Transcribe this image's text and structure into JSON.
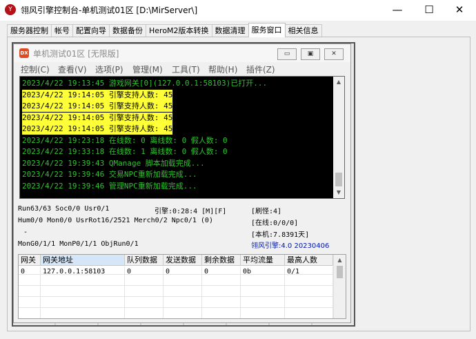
{
  "window": {
    "title": "翎风引擎控制台-单机测试01区 [D:\\MirServer\\]",
    "icon": "engine-logo-icon",
    "minimize": "—",
    "maximize": "☐",
    "close": "✕"
  },
  "tabs": [
    {
      "label": "服务器控制"
    },
    {
      "label": "帐号"
    },
    {
      "label": "配置向导"
    },
    {
      "label": "数据备份"
    },
    {
      "label": "HeroM2版本转换"
    },
    {
      "label": "数据清理"
    },
    {
      "label": "服务窗口",
      "active": true
    },
    {
      "label": "相关信息"
    }
  ],
  "server_window": {
    "title": "单机测试01区 [无限版]",
    "icon_label": "DX",
    "buttons": {
      "minimize": "▭",
      "restore": "▣",
      "close": "✕"
    },
    "menu": [
      "控制(C)",
      "查看(V)",
      "选项(P)",
      "管理(M)",
      "工具(T)",
      "帮助(H)",
      "插件(Z)"
    ]
  },
  "console": {
    "lines": [
      {
        "text": "2023/4/22 19:13:45 游戏网关[0](127.0.0.1:58103)已打开...",
        "highlight": false
      },
      {
        "text": "2023/4/22 19:14:05 引擎支持人数: 45",
        "highlight": true
      },
      {
        "text": "2023/4/22 19:14:05 引擎支持人数: 45",
        "highlight": true
      },
      {
        "text": "2023/4/22 19:14:05 引擎支持人数: 45",
        "highlight": true
      },
      {
        "text": "2023/4/22 19:14:05 引擎支持人数: 45",
        "highlight": true
      },
      {
        "text": "2023/4/22 19:23:18 在线数: 0 离线数: 0 假人数: 0",
        "highlight": false
      },
      {
        "text": "2023/4/22 19:33:18 在线数: 1 离线数: 0 假人数: 0",
        "highlight": false
      },
      {
        "text": "2023/4/22 19:39:43 QManage 脚本加载完成...",
        "highlight": false
      },
      {
        "text": "2023/4/22 19:39:46 交易NPC重新加载完成...",
        "highlight": false
      },
      {
        "text": "2023/4/22 19:39:46 管理NPC重新加载完成...",
        "highlight": false
      }
    ],
    "colors": {
      "text": "#2ec32e",
      "highlight_bg": "#ffff38",
      "background": "#000000"
    }
  },
  "status": {
    "run": "Run63/63 Soc0/0 Usr0/1",
    "engine": "引擎:0:28:4 [M][F]",
    "refresh": "[刷怪:4]",
    "hum": "Hum0/0 Mon0/0 UsrRot16/2521 Merch0/2 Npc0/1 (0)",
    "online": "[在线:0/0/0]",
    "dash": "-",
    "local": "[本机:7.8391天]",
    "mon": "MonG0/1/1 MonP0/1/1 ObjRun0/1",
    "version": "翎风引擎:4.0 20230406"
  },
  "gateway_table": {
    "columns": [
      "网关",
      "网关地址",
      "队列数据",
      "发送数据",
      "剩余数据",
      "平均流量",
      "最高人数"
    ],
    "rows": [
      [
        "0",
        "127.0.0.1:58103",
        "0",
        "0",
        "0",
        "0b",
        "0/1"
      ]
    ]
  }
}
